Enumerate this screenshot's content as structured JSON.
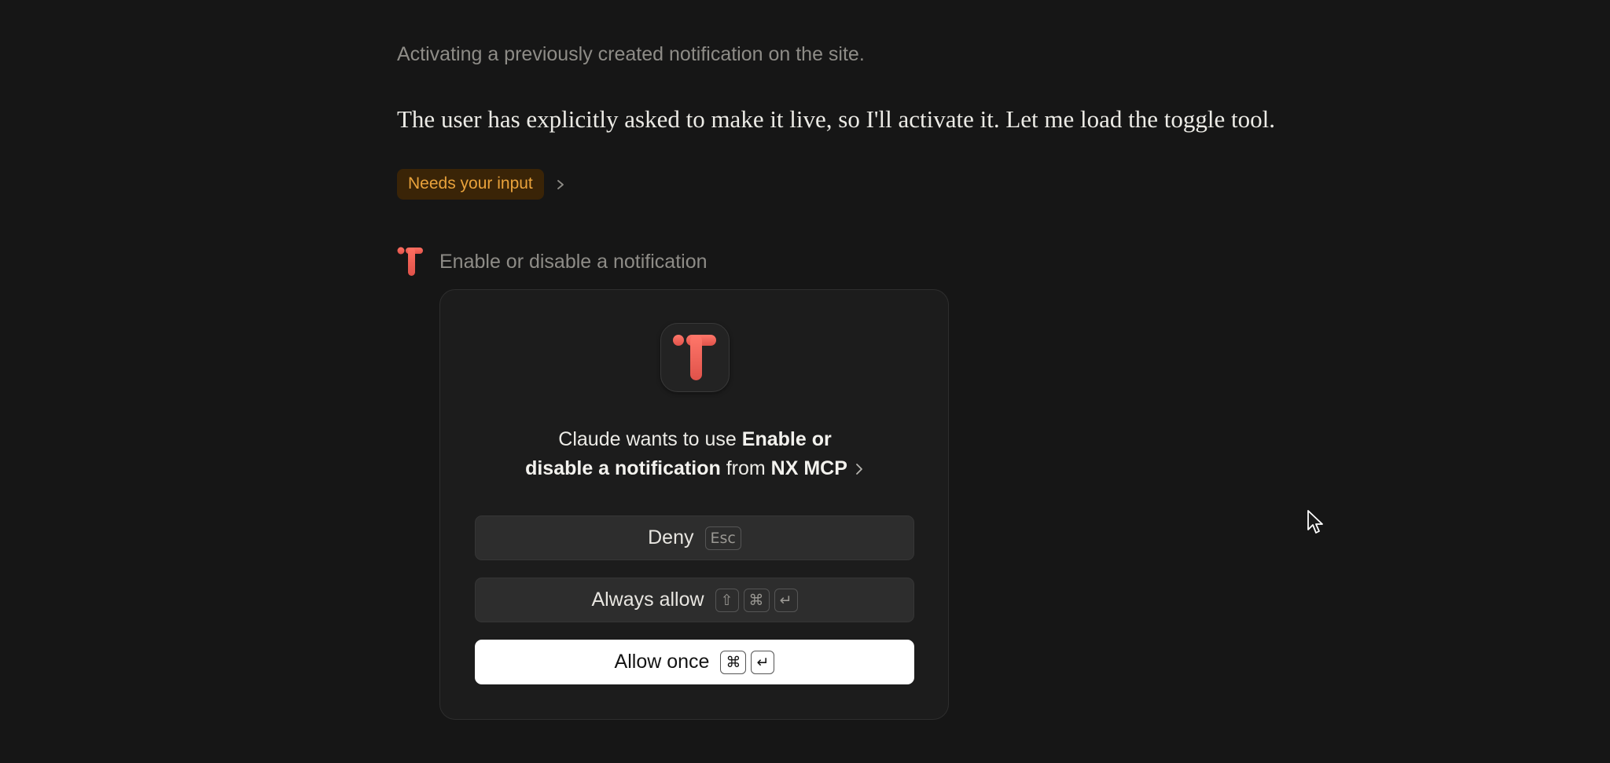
{
  "status_line": "Activating a previously created notification on the site.",
  "assistant_message": "The user has explicitly asked to make it live, so I'll activate it. Let me load the toggle tool.",
  "needs_input": {
    "label": "Needs your input",
    "chevron_icon": "chevron-right-icon"
  },
  "tool_call": {
    "icon": "nx-mcp-logo-icon",
    "label": "Enable or disable a notification"
  },
  "permission": {
    "app_icon": "nx-mcp-logo-icon",
    "title_prefix": "Claude wants to use",
    "tool_name_line1": "Enable or",
    "tool_name_line2": "disable a notification",
    "from_word": "from",
    "server_name": "NX MCP",
    "buttons": {
      "deny": {
        "label": "Deny",
        "shortcut": [
          "Esc"
        ]
      },
      "always_allow": {
        "label": "Always allow",
        "shortcut": [
          "⇧",
          "⌘",
          "↵"
        ]
      },
      "allow_once": {
        "label": "Allow once",
        "shortcut": [
          "⌘",
          "↵"
        ]
      }
    }
  },
  "colors": {
    "background": "#161616",
    "accent_orange": "#e9a23b",
    "logo_red": "#f2675e"
  }
}
